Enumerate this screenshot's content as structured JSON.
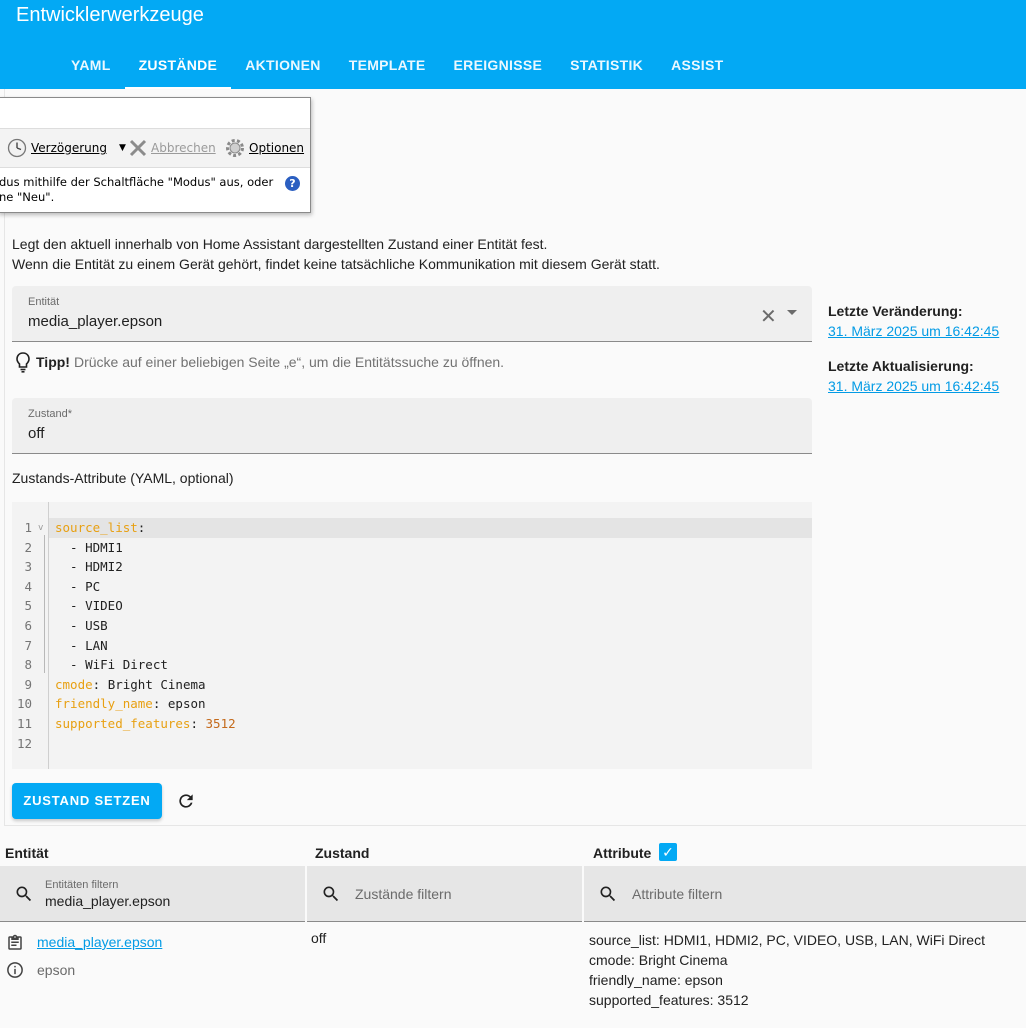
{
  "app": {
    "title": "Entwicklerwerkzeuge",
    "tabs": [
      "YAML",
      "ZUSTÄNDE",
      "AKTIONEN",
      "TEMPLATE",
      "EREIGNISSE",
      "STATISTIK",
      "ASSIST"
    ],
    "active_tab": "ZUSTÄNDE"
  },
  "snipping_tool": {
    "delay_label": "Verzögerung",
    "cancel_label": "Abbrechen",
    "options_label": "Optionen",
    "hint_line1": "dus mithilfe der Schaltfläche \"Modus\" aus, oder",
    "hint_line2": "ne \"Neu\"."
  },
  "description": {
    "line1": "Legt den aktuell innerhalb von Home Assistant dargestellten Zustand einer Entität fest.",
    "line2": "Wenn die Entität zu einem Gerät gehört, findet keine tatsächliche Kommunikation mit diesem Gerät statt."
  },
  "entity_field": {
    "label": "Entität",
    "value": "media_player.epson"
  },
  "tip": {
    "bold": "Tipp!",
    "text": "Drücke auf einer beliebigen Seite „e“, um die Entitätssuche zu öffnen."
  },
  "state_field": {
    "label": "Zustand*",
    "value": "off"
  },
  "attributes_label": "Zustands-Attribute (YAML, optional)",
  "side_info": {
    "last_changed_label": "Letzte Veränderung:",
    "last_changed_value": "31. März 2025 um 16:42:45",
    "last_updated_label": "Letzte Aktualisierung:",
    "last_updated_value": "31. März 2025 um 16:42:45"
  },
  "yaml_lines": [
    {
      "key": "source_list",
      "sep": ":",
      "val": ""
    },
    {
      "key": "",
      "sep": "",
      "val": "  - HDMI1"
    },
    {
      "key": "",
      "sep": "",
      "val": "  - HDMI2"
    },
    {
      "key": "",
      "sep": "",
      "val": "  - PC"
    },
    {
      "key": "",
      "sep": "",
      "val": "  - VIDEO"
    },
    {
      "key": "",
      "sep": "",
      "val": "  - USB"
    },
    {
      "key": "",
      "sep": "",
      "val": "  - LAN"
    },
    {
      "key": "",
      "sep": "",
      "val": "  - WiFi Direct"
    },
    {
      "key": "cmode",
      "sep": ": ",
      "val": "Bright Cinema"
    },
    {
      "key": "friendly_name",
      "sep": ": ",
      "val": "epson"
    },
    {
      "key": "supported_features",
      "sep": ": ",
      "num": "3512"
    },
    {
      "key": "",
      "sep": "",
      "val": ""
    }
  ],
  "set_button_label": "ZUSTAND SETZEN",
  "table": {
    "col_entity": "Entität",
    "col_state": "Zustand",
    "col_attributes": "Attribute",
    "entity_filter_label": "Entitäten filtern",
    "entity_filter_value": "media_player.epson",
    "state_filter_placeholder": "Zustände filtern",
    "attr_filter_placeholder": "Attribute filtern",
    "row": {
      "entity_id": "media_player.epson",
      "friendly_name": "epson",
      "state": "off",
      "attributes": [
        "source_list: HDMI1, HDMI2, PC, VIDEO, USB, LAN, WiFi Direct",
        "cmode: Bright Cinema",
        "friendly_name: epson",
        "supported_features: 3512"
      ]
    }
  },
  "colors": {
    "accent": "#03a9f4",
    "link": "#039be5",
    "yaml_key": "#e8a012"
  }
}
